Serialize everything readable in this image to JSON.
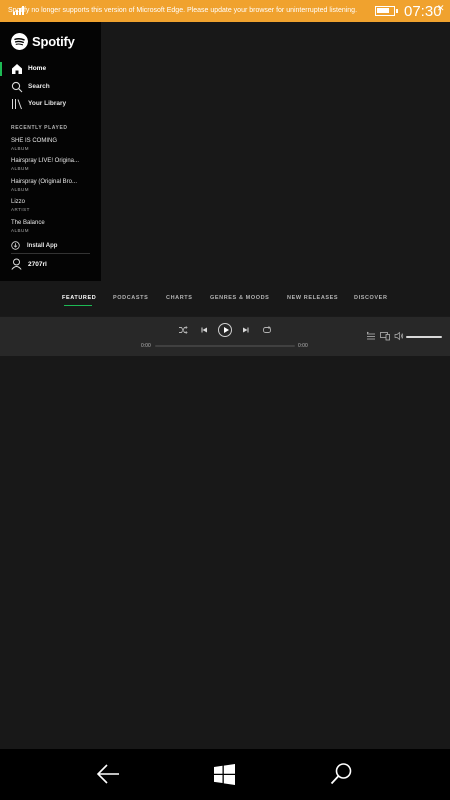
{
  "banner": {
    "message": "Spotify no longer supports this version of Microsoft Edge. Please update your browser for uninterrupted listening.",
    "time": "07:30",
    "color": "#f0a22e"
  },
  "sidebar": {
    "brand": "Spotify",
    "nav": [
      {
        "label": "Home",
        "icon": "home-icon",
        "active": true
      },
      {
        "label": "Search",
        "icon": "search-icon",
        "active": false
      },
      {
        "label": "Your Library",
        "icon": "library-icon",
        "active": false
      }
    ],
    "recent_heading": "RECENTLY PLAYED",
    "recent": [
      {
        "title": "SHE IS COMING",
        "type": "ALBUM"
      },
      {
        "title": "Hairspray LIVE! Origina...",
        "type": "ALBUM"
      },
      {
        "title": "Hairspray (Original Bro...",
        "type": "ALBUM"
      },
      {
        "title": "Lizzo",
        "type": "ARTIST"
      },
      {
        "title": "The Balance",
        "type": "ALBUM"
      }
    ],
    "install_label": "Install App",
    "username": "2707rl"
  },
  "tabs": [
    {
      "label": "FEATURED",
      "active": true
    },
    {
      "label": "PODCASTS",
      "active": false
    },
    {
      "label": "CHARTS",
      "active": false
    },
    {
      "label": "GENRES & MOODS",
      "active": false
    },
    {
      "label": "NEW RELEASES",
      "active": false
    },
    {
      "label": "DISCOVER",
      "active": false
    }
  ],
  "player": {
    "elapsed": "0:00",
    "duration": "0:00",
    "progress": 0,
    "volume": 1.0
  },
  "colors": {
    "accent": "#1db954",
    "background": "#181818",
    "sidebar": "#040404",
    "player": "#282828"
  }
}
